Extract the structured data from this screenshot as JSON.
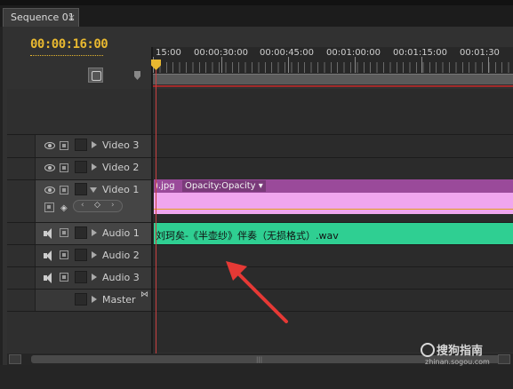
{
  "tab": {
    "title": "Sequence 01",
    "close": "×"
  },
  "timecode": "00:00:16:00",
  "ruler": {
    "labels": [
      "15:00",
      "00:00:30:00",
      "00:00:45:00",
      "00:01:00:00",
      "00:01:15:00",
      "00:01:30"
    ]
  },
  "tracks": {
    "video": [
      {
        "name": "Video 3"
      },
      {
        "name": "Video 2"
      },
      {
        "name": "Video 1"
      }
    ],
    "audio": [
      {
        "name": "Audio 1"
      },
      {
        "name": "Audio 2"
      },
      {
        "name": "Audio 3"
      }
    ],
    "master": {
      "name": "Master"
    }
  },
  "clips": {
    "video": {
      "name": ").jpg",
      "effect": "Opacity:Opacity"
    },
    "audio": {
      "name": "刘珂矣-《半壶纱》伴奏（无损格式）.wav"
    }
  },
  "watermark": {
    "brand": "搜狗指南",
    "url": "zhinan.sogou.com"
  },
  "colors": {
    "timecode": "#e8b830",
    "video_clip": "#f0a6ee",
    "audio_clip": "#2fcf92",
    "playhead": "#c84040"
  }
}
